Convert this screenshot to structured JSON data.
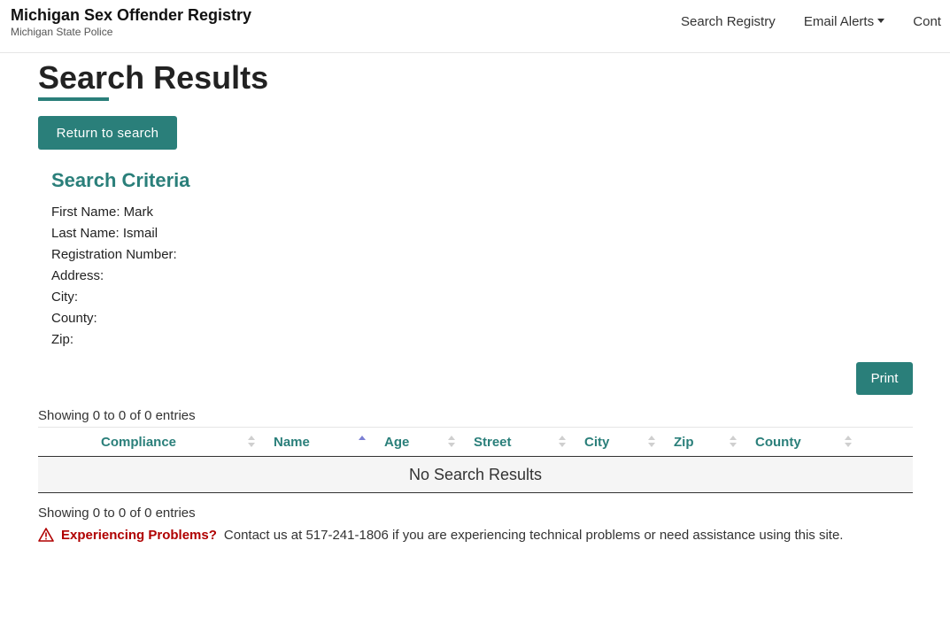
{
  "header": {
    "title": "Michigan Sex Offender Registry",
    "subtitle": "Michigan State Police",
    "nav": {
      "search_registry": "Search Registry",
      "email_alerts": "Email Alerts",
      "contact": "Cont"
    }
  },
  "page": {
    "title": "Search Results",
    "return_button": "Return to search",
    "print_button": "Print"
  },
  "criteria": {
    "heading": "Search Criteria",
    "lines": [
      "First Name: Mark",
      "Last Name: Ismail",
      "Registration Number:",
      "Address:",
      "City:",
      "County:",
      "Zip:"
    ]
  },
  "table": {
    "showing_top": "Showing 0 to 0 of 0 entries",
    "showing_bottom": "Showing 0 to 0 of 0 entries",
    "columns": [
      "Compliance",
      "Name",
      "Age",
      "Street",
      "City",
      "Zip",
      "County"
    ],
    "sorted_column": "Name",
    "empty_message": "No Search Results"
  },
  "problems": {
    "icon": "warning-icon",
    "title": "Experiencing Problems?",
    "text": "Contact us at 517-241-1806 if you are experiencing technical problems or need assistance using this site."
  },
  "colors": {
    "accent": "#2a7f7a",
    "warning": "#b00000"
  }
}
